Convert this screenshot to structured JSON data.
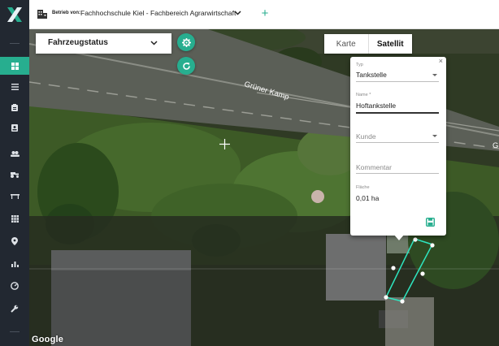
{
  "sidebar": {
    "logo": "x-logo",
    "items": [
      {
        "icon": "dashboard-icon",
        "active": true
      },
      {
        "icon": "list-icon",
        "active": false
      },
      {
        "icon": "clipboard-icon",
        "active": false
      },
      {
        "icon": "badge-icon",
        "active": false
      },
      {
        "icon": "users-icon",
        "active": false
      },
      {
        "icon": "tractor-icon",
        "active": false
      },
      {
        "icon": "implement-icon",
        "active": false
      },
      {
        "icon": "grid-icon",
        "active": false
      },
      {
        "icon": "map-pin-icon",
        "active": false
      },
      {
        "icon": "bar-chart-icon",
        "active": false
      },
      {
        "icon": "gauge-icon",
        "active": false
      },
      {
        "icon": "wrench-icon",
        "active": false
      }
    ]
  },
  "topbar": {
    "betrieb_label": "Betrieb von:",
    "betrieb_name": "Fachhochschule Kiel - Fachbereich Agrarwirtschaft",
    "add_label": "+"
  },
  "map": {
    "vehicle_status_label": "Fahrzeugstatus",
    "maptype": {
      "karte": "Karte",
      "satellit": "Satellit",
      "selected": "Satellit"
    },
    "street_label": "Grüner Kamp",
    "street_label_edge": "G",
    "attribution": "Google",
    "polygon_color": "#2ee6c0"
  },
  "popup": {
    "close": "×",
    "typ_label": "Typ",
    "typ_value": "Tankstelle",
    "name_label": "Name *",
    "name_value": "Hoftankstelle",
    "kunde_placeholder": "Kunde",
    "kommentar_placeholder": "Kommentar",
    "flaeche_label": "Fläche",
    "flaeche_value": "0,01 ha"
  },
  "colors": {
    "accent": "#27ae8f",
    "sidebar_bg": "#222831"
  }
}
